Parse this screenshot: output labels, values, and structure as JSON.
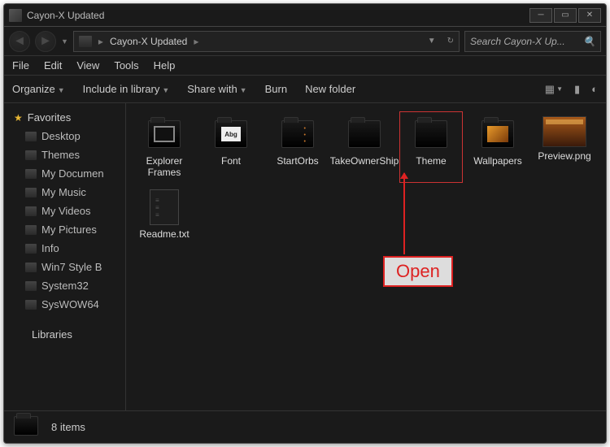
{
  "window": {
    "title": "Cayon-X Updated"
  },
  "breadcrumb": {
    "path": "Cayon-X Updated",
    "separator": "▸"
  },
  "search": {
    "placeholder": "Search Cayon-X Up..."
  },
  "menubar": [
    "File",
    "Edit",
    "View",
    "Tools",
    "Help"
  ],
  "toolbar": {
    "items": [
      "Organize",
      "Include in library",
      "Share with",
      "Burn",
      "New folder"
    ],
    "has_dropdown": [
      true,
      true,
      true,
      false,
      false
    ]
  },
  "sidebar": {
    "favorites_label": "Favorites",
    "favorites": [
      "Desktop",
      "Themes",
      "My Documen",
      "My Music",
      "My Videos",
      "My Pictures",
      "Info",
      "Win7 Style B",
      "System32",
      "SysWOW64"
    ],
    "libraries_label": "Libraries"
  },
  "files": [
    {
      "name": "Explorer Frames",
      "kind": "folder-frames"
    },
    {
      "name": "Font",
      "kind": "folder-font"
    },
    {
      "name": "StartOrbs",
      "kind": "folder-orbs"
    },
    {
      "name": "TakeOwnerShip",
      "kind": "folder"
    },
    {
      "name": "Theme",
      "kind": "folder",
      "highlight": true
    },
    {
      "name": "Wallpapers",
      "kind": "folder-wall"
    },
    {
      "name": "Preview.png",
      "kind": "preview"
    },
    {
      "name": "Readme.txt",
      "kind": "txt"
    }
  ],
  "statusbar": {
    "text": "8 items"
  },
  "annotation": {
    "label": "Open"
  }
}
